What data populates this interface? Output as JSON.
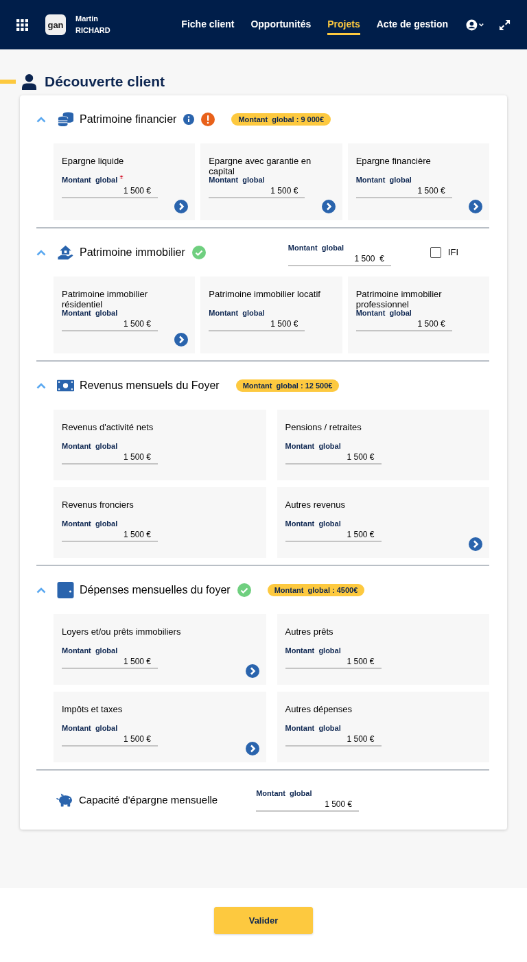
{
  "header": {
    "user_first": "Martin",
    "user_last": "RICHARD",
    "logo": "gan",
    "nav": [
      {
        "label": "Fiche client",
        "selected": false
      },
      {
        "label": "Opportunités",
        "selected": false
      },
      {
        "label": "Projets",
        "selected": true
      },
      {
        "label": "Acte de gestion",
        "selected": false
      }
    ]
  },
  "page_title": "Découverte client",
  "sections": [
    {
      "title": "Patrimoine financier",
      "info": true,
      "warning": true,
      "complete": false,
      "badge": "Montant  global : 9 000€",
      "expanded": true,
      "cards": [
        {
          "title": "Epargne liquide",
          "label": "Montant  global",
          "required": true,
          "value": "1 500 €",
          "arrow": true
        },
        {
          "title": "Epargne avec garantie en capital",
          "label": "Montant  global",
          "required": false,
          "value": "1 500 €",
          "arrow": true
        },
        {
          "title": "Epargne financière",
          "label": "Montant  global",
          "required": false,
          "value": "1 500 €",
          "arrow": true
        }
      ]
    },
    {
      "title": "Patrimoine immobilier",
      "info": false,
      "warning": false,
      "complete": true,
      "expanded": true,
      "global_field": {
        "label": "Montant  global",
        "value": "1 500  €"
      },
      "checkbox": {
        "label": "IFI",
        "checked": false
      },
      "cards": [
        {
          "title": "Patrimoine immobilier résidentiel",
          "label": "Montant  global",
          "required": false,
          "value": "1 500 €",
          "arrow": true
        },
        {
          "title": "Patrimoine immobilier locatif",
          "label": "Montant  global",
          "required": false,
          "value": "1 500 €",
          "arrow": false
        },
        {
          "title": "Patrimoine immobilier professionnel",
          "label": "Montant  global",
          "required": false,
          "value": "1 500 €",
          "arrow": false
        }
      ]
    },
    {
      "title": "Revenus mensuels du Foyer",
      "info": false,
      "warning": false,
      "complete": false,
      "badge": "Montant  global : 12 500€",
      "expanded": true,
      "cards": [
        {
          "title": "Revenus d'activité nets",
          "label": "Montant  global",
          "required": false,
          "value": "1 500 €",
          "arrow": false
        },
        {
          "title": "Pensions / retraites",
          "label": "Montant  global",
          "required": false,
          "value": "1 500 €",
          "arrow": false
        },
        {
          "title": "Revenus fronciers",
          "label": "Montant  global",
          "required": false,
          "value": "1 500 €",
          "arrow": false
        },
        {
          "title": "Autres revenus",
          "label": "Montant  global",
          "required": false,
          "value": "1 500 €",
          "arrow": true
        }
      ]
    },
    {
      "title": "Dépenses mensuelles du foyer",
      "info": false,
      "warning": false,
      "complete": true,
      "badge": "Montant  global : 4500€",
      "expanded": true,
      "cards": [
        {
          "title": "Loyers et/ou prêts immobiliers",
          "label": "Montant  global",
          "required": false,
          "value": "1 500 €",
          "arrow": true
        },
        {
          "title": "Autres prêts",
          "label": "Montant  global",
          "required": false,
          "value": "1 500 €",
          "arrow": false
        },
        {
          "title": "Impôts et taxes",
          "label": "Montant  global",
          "required": false,
          "value": "1 500 €",
          "arrow": true
        },
        {
          "title": "Autres dépenses",
          "label": "Montant  global",
          "required": false,
          "value": "1 500 €",
          "arrow": false
        }
      ]
    }
  ],
  "capacity": {
    "title": "Capacité d'épargne mensuelle",
    "label": "Montant  global",
    "value": "1 500 €"
  },
  "submit": "Valider"
}
